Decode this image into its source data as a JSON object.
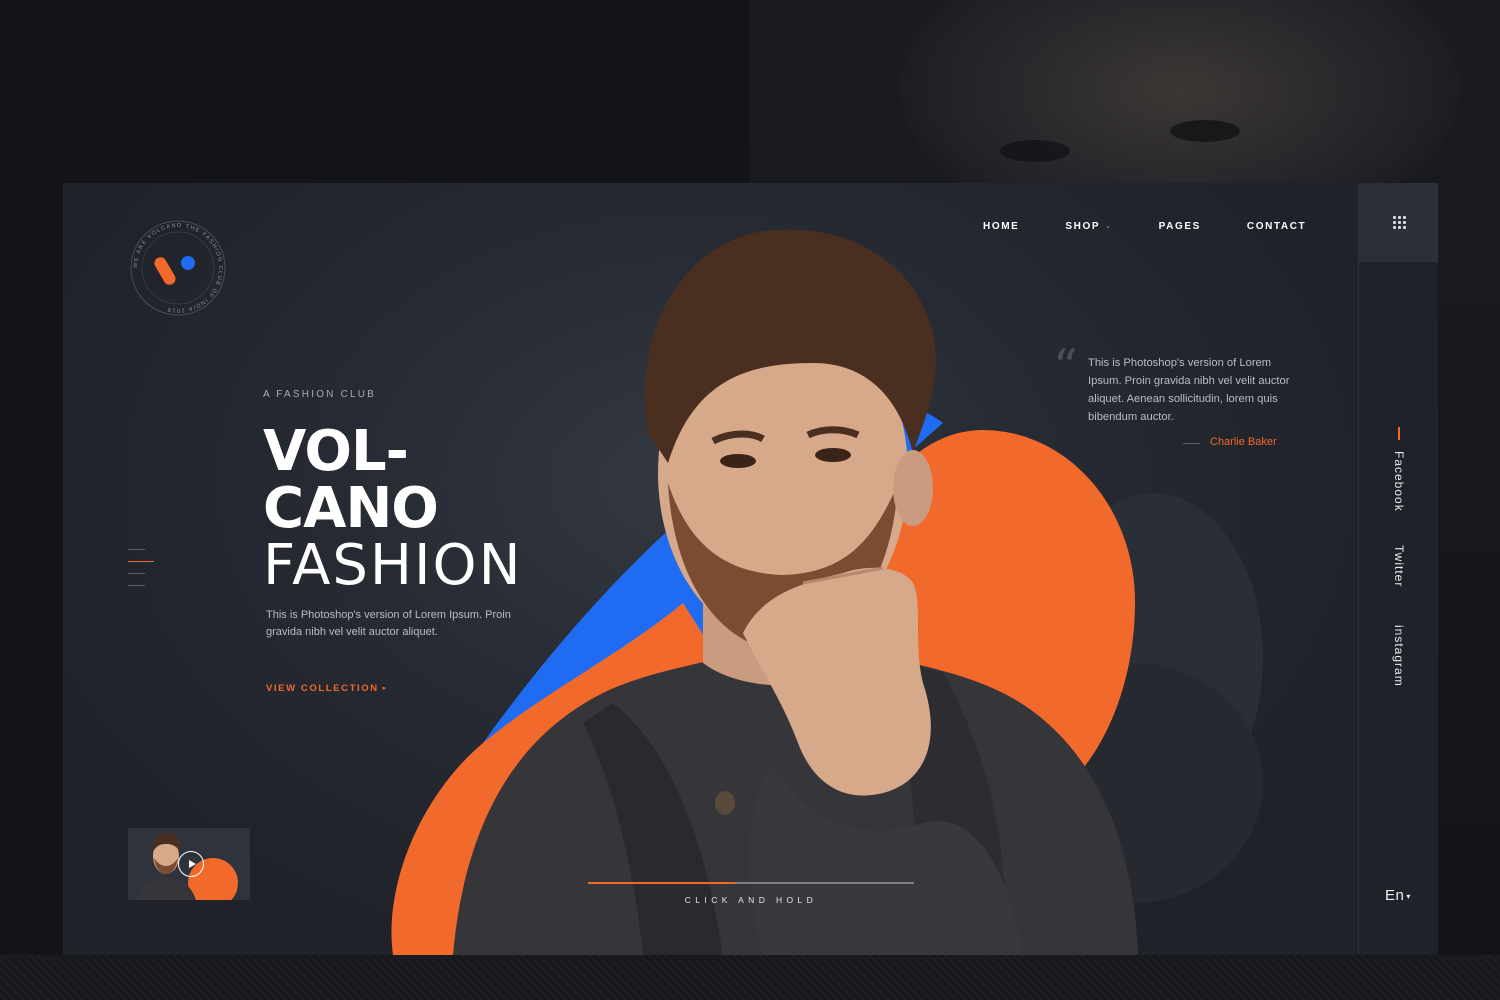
{
  "brand": {
    "logo_ring_text": "WE ARE VOLCANO THE FASHION CLUB OF INDIA 2018",
    "logo_icon": "volcano-v-logo"
  },
  "nav": {
    "items": [
      {
        "label": "HOME",
        "has_dropdown": false
      },
      {
        "label": "SHOP",
        "has_dropdown": true
      },
      {
        "label": "PAGES",
        "has_dropdown": false
      },
      {
        "label": "CONTACT",
        "has_dropdown": false
      }
    ],
    "menu_icon": "grid-menu-icon"
  },
  "hero": {
    "eyebrow": "A FASHION CLUB",
    "title_line1": "VOL-",
    "title_line2": "CANO",
    "title_line3": "FASHION",
    "description": "This is Photoshop's version  of Lorem Ipsum. Proin gravida nibh vel velit auctor aliquet.",
    "cta_label": "VIEW COLLECTION",
    "cta_icon": "caret-right-icon"
  },
  "slides": {
    "count": 4,
    "active_index": 1
  },
  "quote": {
    "text": "This is Photoshop's version  of Lorem Ipsum. Proin gravida nibh vel velit auctor aliquet. Aenean sollicitudin, lorem quis bibendum auctor.",
    "author": "Charlie Baker"
  },
  "social": {
    "items": [
      "Facebook",
      "Twitter",
      "instagram"
    ]
  },
  "language": {
    "current": "En"
  },
  "hold": {
    "label": "CLICK AND HOLD",
    "progress": 0.45
  },
  "video_thumb": {
    "icon": "play-icon"
  },
  "colors": {
    "accent": "#f26a2b",
    "blue": "#1f6cf2",
    "card_bg": "#262a32",
    "page_bg": "#121419"
  }
}
